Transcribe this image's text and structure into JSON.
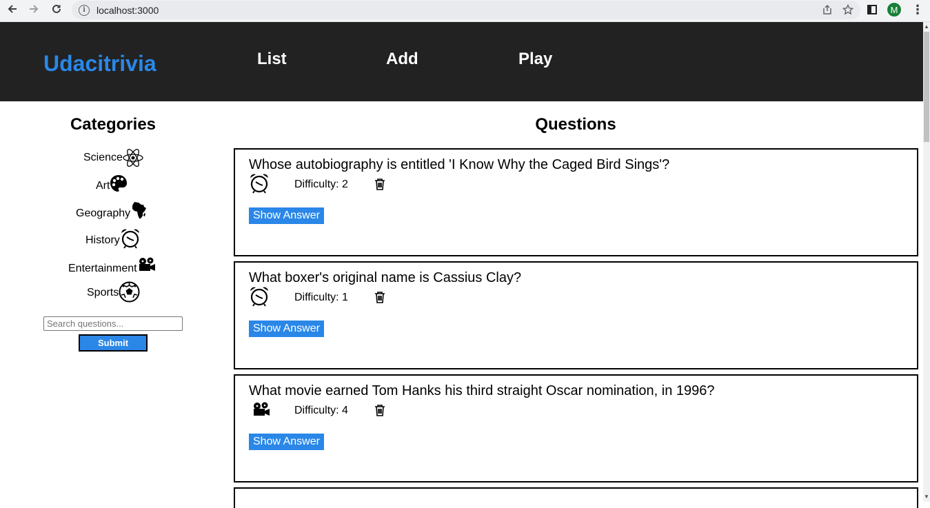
{
  "browser": {
    "url": "localhost:3000",
    "profile_initial": "M"
  },
  "header": {
    "logo": "Udacitrivia",
    "nav": [
      {
        "label": "List"
      },
      {
        "label": "Add"
      },
      {
        "label": "Play"
      }
    ]
  },
  "categories": {
    "title": "Categories",
    "items": [
      {
        "label": "Science",
        "icon": "atom-icon"
      },
      {
        "label": "Art",
        "icon": "palette-icon"
      },
      {
        "label": "Geography",
        "icon": "africa-icon"
      },
      {
        "label": "History",
        "icon": "alarm-clock-icon"
      },
      {
        "label": "Entertainment",
        "icon": "film-camera-icon"
      },
      {
        "label": "Sports",
        "icon": "soccer-ball-icon"
      }
    ],
    "search_placeholder": "Search questions...",
    "submit_label": "Submit"
  },
  "questions": {
    "title": "Questions",
    "list": [
      {
        "text": "Whose autobiography is entitled 'I Know Why the Caged Bird Sings'?",
        "difficulty": "Difficulty: 2",
        "category_icon": "alarm-clock-icon",
        "button": "Show Answer"
      },
      {
        "text": "What boxer's original name is Cassius Clay?",
        "difficulty": "Difficulty: 1",
        "category_icon": "alarm-clock-icon",
        "button": "Show Answer"
      },
      {
        "text": "What movie earned Tom Hanks his third straight Oscar nomination, in 1996?",
        "difficulty": "Difficulty: 4",
        "category_icon": "film-camera-icon",
        "button": "Show Answer"
      }
    ]
  }
}
